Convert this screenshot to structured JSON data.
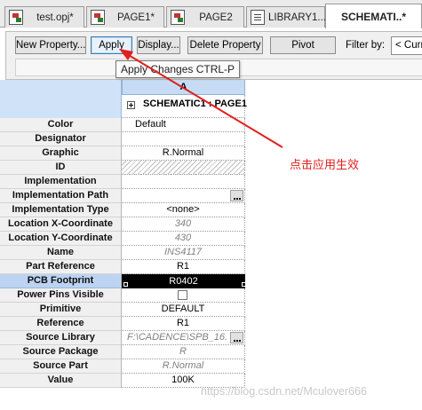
{
  "tabs": [
    {
      "label": "test.opj*",
      "icon": "project-icon",
      "active": false
    },
    {
      "label": "PAGE1*",
      "icon": "schematic-page-icon",
      "active": false
    },
    {
      "label": "PAGE2",
      "icon": "schematic-page-icon",
      "active": false
    },
    {
      "label": "LIBRARY1....",
      "icon": "library-icon",
      "active": false
    },
    {
      "label": "SCHEMATI..*",
      "icon": "",
      "active": true
    }
  ],
  "toolbar": {
    "new_property": "New Property...",
    "apply": "Apply",
    "display": "Display...",
    "delete_property": "Delete Property",
    "pivot": "Pivot",
    "filter_label": "Filter by:",
    "filter_value": "< Curre"
  },
  "tooltip": "Apply Changes CTRL-P",
  "grid": {
    "column_header": "A",
    "column_subheader": "SCHEMATIC1 : PAGE1",
    "rows": [
      {
        "name": "Color",
        "value": "Default"
      },
      {
        "name": "Designator",
        "value": ""
      },
      {
        "name": "Graphic",
        "value": "R.Normal"
      },
      {
        "name": "ID",
        "value": ""
      },
      {
        "name": "Implementation",
        "value": ""
      },
      {
        "name": "Implementation Path",
        "value": ""
      },
      {
        "name": "Implementation Type",
        "value": "<none>"
      },
      {
        "name": "Location X-Coordinate",
        "value": "340"
      },
      {
        "name": "Location Y-Coordinate",
        "value": "430"
      },
      {
        "name": "Name",
        "value": "INS4117"
      },
      {
        "name": "Part Reference",
        "value": "R1"
      },
      {
        "name": "PCB Footprint",
        "value": "R0402"
      },
      {
        "name": "Power Pins Visible",
        "value": ""
      },
      {
        "name": "Primitive",
        "value": "DEFAULT"
      },
      {
        "name": "Reference",
        "value": "R1"
      },
      {
        "name": "Source Library",
        "value": "F:\\CADENCE\\SPB_16."
      },
      {
        "name": "Source Package",
        "value": "R"
      },
      {
        "name": "Source Part",
        "value": "R.Normal"
      },
      {
        "name": "Value",
        "value": "100K"
      }
    ]
  },
  "annotation": {
    "text": "点击应用生效",
    "color": "#e0201f"
  },
  "watermark": "https://blog.csdn.net/Mculover666"
}
